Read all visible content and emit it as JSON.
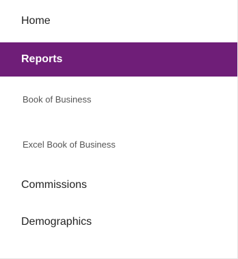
{
  "nav": {
    "items": [
      {
        "label": "Home"
      },
      {
        "label": "Reports",
        "active": true
      },
      {
        "label": "Book of Business",
        "level": "sub"
      },
      {
        "label": "Excel Book of Business",
        "level": "sub"
      },
      {
        "label": "Commissions"
      },
      {
        "label": "Demographics"
      }
    ],
    "active_color": "#6f1e78"
  }
}
